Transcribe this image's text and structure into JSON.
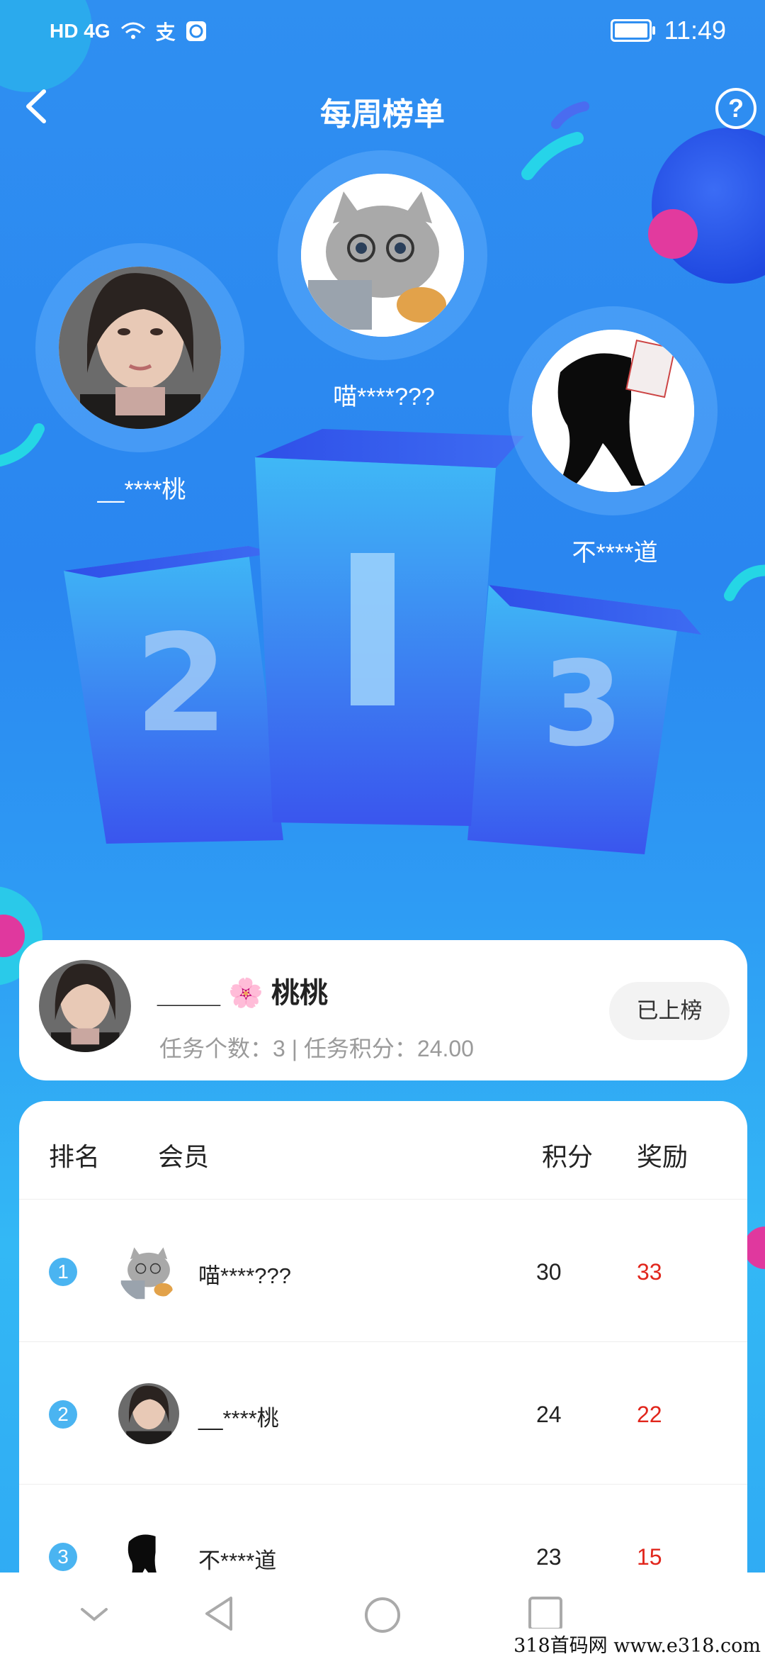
{
  "status_bar": {
    "signal": "HD 4G",
    "pay_icon_char": "支",
    "time": "11:49"
  },
  "header": {
    "title": "每周榜单",
    "help_label": "?"
  },
  "podium": {
    "first_name": "喵****???",
    "second_name": "__****桃",
    "third_name": "不****道",
    "labels": [
      "2",
      "1",
      "3"
    ]
  },
  "me_card": {
    "name_prefix": "____",
    "name_flower": "🌸",
    "name_suffix": "桃桃",
    "stats": "任务个数：3 | 任务积分：24.00",
    "status_button": "已上榜"
  },
  "table": {
    "headers": {
      "rank": "排名",
      "member": "会员",
      "score": "积分",
      "reward": "奖励"
    },
    "rows": [
      {
        "rank": "1",
        "name": "喵****???",
        "score": "30",
        "reward": "33"
      },
      {
        "rank": "2",
        "name": "__****桃",
        "score": "24",
        "reward": "22"
      },
      {
        "rank": "3",
        "name": "不****道",
        "score": "23",
        "reward": "15"
      }
    ]
  },
  "watermark": "318首码网  www.e318.com",
  "colors": {
    "accent": "#2b8df0",
    "reward": "#e1261c",
    "rank_badge": "#4ab4f1"
  }
}
